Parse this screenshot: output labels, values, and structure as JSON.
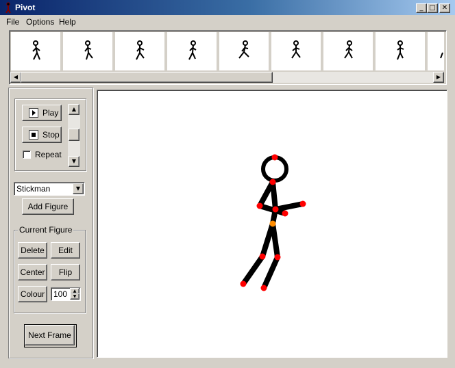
{
  "window": {
    "title": "Pivot"
  },
  "menu": [
    {
      "label": "File"
    },
    {
      "label": "Options"
    },
    {
      "label": "Help"
    }
  ],
  "animation": {
    "play_label": "Play",
    "stop_label": "Stop",
    "repeat_label": "Repeat",
    "repeat_checked": false
  },
  "figure_select": {
    "value": "Stickman"
  },
  "add_figure_label": "Add Figure",
  "current_figure": {
    "group_label": "Current Figure",
    "delete_label": "Delete",
    "edit_label": "Edit",
    "center_label": "Center",
    "flip_label": "Flip",
    "colour_label": "Colour",
    "size_value": "100"
  },
  "next_frame_label": "Next Frame",
  "colors": {
    "joint": "#ff0000",
    "center_joint": "#ff8c00",
    "limb": "#000000",
    "titlebar": "#0a246a"
  }
}
